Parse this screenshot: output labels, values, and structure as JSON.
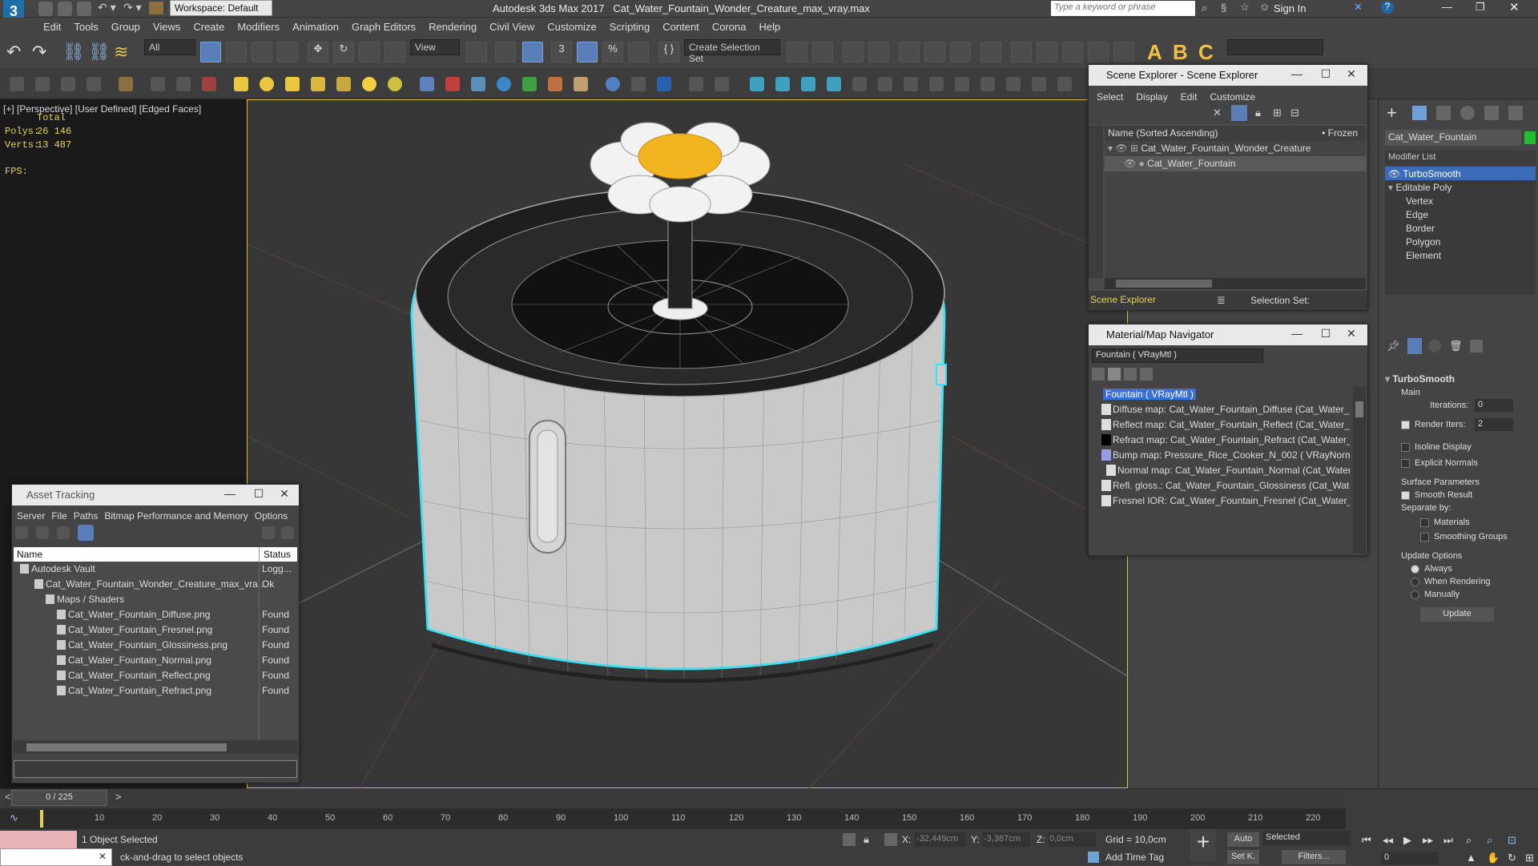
{
  "titlebar": {
    "workspace": "Workspace: Default",
    "app_title": "Autodesk 3ds Max 2017",
    "file_name": "Cat_Water_Fountain_Wonder_Creature_max_vray.max",
    "search_placeholder": "Type a keyword or phrase",
    "sign_in": "Sign In"
  },
  "menu": [
    "Edit",
    "Tools",
    "Group",
    "Views",
    "Create",
    "Modifiers",
    "Animation",
    "Graph Editors",
    "Rendering",
    "Civil View",
    "Customize",
    "Scripting",
    "Content",
    "Corona",
    "Help"
  ],
  "toolbar": {
    "filter_all": "All",
    "ref_coord": "View",
    "selection_set": "Create Selection Set"
  },
  "viewport": {
    "label_plus": "[+]",
    "label_view": "[Perspective]",
    "label_shading": "[User Defined]",
    "label_edges": "[Edged Faces]",
    "stats_total": "Total",
    "polys_label": "Polys:",
    "polys_value": "26 146",
    "verts_label": "Verts:",
    "verts_value": "13 487",
    "fps_label": "FPS:"
  },
  "scene_explorer": {
    "title": "Scene Explorer - Scene Explorer",
    "menu": [
      "Select",
      "Display",
      "Edit",
      "Customize"
    ],
    "col_name": "Name (Sorted Ascending)",
    "col_frozen": "• Frozen",
    "rows": [
      "Cat_Water_Fountain_Wonder_Creature",
      "Cat_Water_Fountain"
    ],
    "footer_name": "Scene Explorer",
    "selection_set": "Selection Set:"
  },
  "material_nav": {
    "title": "Material/Map Navigator",
    "field": "Fountain  ( VRayMtl )",
    "root": "Fountain  ( VRayMtl )",
    "items": [
      "Diffuse map: Cat_Water_Fountain_Diffuse (Cat_Water_Fountai",
      "Reflect map: Cat_Water_Fountain_Reflect (Cat_Water_Fountai",
      "Refract map: Cat_Water_Fountain_Refract (Cat_Water_Fountai",
      "Bump map: Pressure_Rice_Cooker_N_002  ( VRayNormalMap",
      "Normal map: Cat_Water_Fountain_Normal (Cat_Water_Foun",
      "Refl. gloss.: Cat_Water_Fountain_Glossiness (Cat_Water_Fount",
      "Fresnel IOR: Cat_Water_Fountain_Fresnel (Cat_Water_Fount"
    ]
  },
  "asset_tracking": {
    "title": "Asset Tracking",
    "menu": [
      "Server",
      "File",
      "Paths",
      "Bitmap Performance and Memory",
      "Options"
    ],
    "col_name": "Name",
    "col_status": "Status",
    "rows": [
      {
        "name": "Autodesk Vault",
        "status": "Logg..."
      },
      {
        "name": "Cat_Water_Fountain_Wonder_Creature_max_vra...",
        "status": "Ok"
      },
      {
        "name": "Maps / Shaders",
        "status": ""
      },
      {
        "name": "Cat_Water_Fountain_Diffuse.png",
        "status": "Found"
      },
      {
        "name": "Cat_Water_Fountain_Fresnel.png",
        "status": "Found"
      },
      {
        "name": "Cat_Water_Fountain_Glossiness.png",
        "status": "Found"
      },
      {
        "name": "Cat_Water_Fountain_Normal.png",
        "status": "Found"
      },
      {
        "name": "Cat_Water_Fountain_Reflect.png",
        "status": "Found"
      },
      {
        "name": "Cat_Water_Fountain_Refract.png",
        "status": "Found"
      }
    ]
  },
  "command_panel": {
    "object_name": "Cat_Water_Fountain",
    "object_color": "#1fbf2f",
    "modifier_list": "Modifier List",
    "stack": [
      "TurboSmooth",
      "Editable Poly",
      "Vertex",
      "Edge",
      "Border",
      "Polygon",
      "Element"
    ],
    "rollout_title": "TurboSmooth",
    "main": "Main",
    "iterations_label": "Iterations:",
    "iterations_value": "0",
    "render_iters_label": "Render Iters:",
    "render_iters_value": "2",
    "isoline": "Isoline Display",
    "explicit_normals": "Explicit Normals",
    "surface_params": "Surface Parameters",
    "smooth_result": "Smooth Result",
    "separate_by": "Separate by:",
    "materials": "Materials",
    "smoothing_groups": "Smoothing Groups",
    "update_options": "Update Options",
    "always": "Always",
    "when_rendering": "When Rendering",
    "manually": "Manually",
    "update_btn": "Update"
  },
  "timeline": {
    "frame": "0 / 225",
    "ticks": [
      "10",
      "20",
      "30",
      "40",
      "50",
      "60",
      "70",
      "80",
      "90",
      "100",
      "110",
      "120",
      "130",
      "140",
      "150",
      "160",
      "170",
      "180",
      "190",
      "200",
      "210",
      "220"
    ]
  },
  "status": {
    "selected": "1 Object Selected",
    "prompt": "ck-and-drag to select objects",
    "x_label": "X:",
    "x_value": "-32,449cm",
    "y_label": "Y:",
    "y_value": "-3,387cm",
    "z_label": "Z:",
    "z_value": "0,0cm",
    "grid": "Grid = 10,0cm",
    "add_time_tag": "Add Time Tag",
    "auto": "Auto",
    "selected_dd": "Selected",
    "set_k": "Set K.",
    "filters": "Filters...",
    "frame_field": "0"
  }
}
